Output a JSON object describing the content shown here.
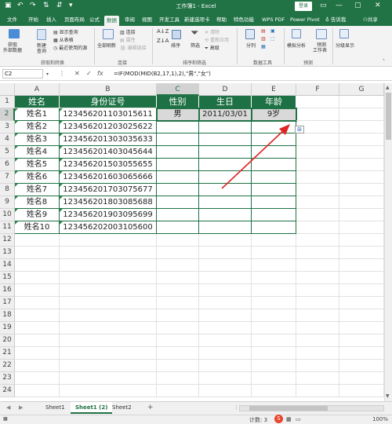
{
  "titlebar": {
    "title": "工作簿1 - Excel",
    "login": "登录",
    "minimize_glyph": "—",
    "restore_glyph": "▢",
    "close_glyph": "✕"
  },
  "tabs": [
    "文件",
    "开始",
    "插入",
    "页面布局",
    "公式",
    "数据",
    "审阅",
    "视图",
    "开发工具",
    "新建选项卡",
    "帮助",
    "特色功能",
    "WPS PDF",
    "Power Pivot"
  ],
  "active_tab": "数据",
  "tell_me": "告诉我",
  "share": "共享",
  "ribbon": {
    "get_data": "获取",
    "get_data2": "外部数据",
    "new_query": "新建",
    "new_query2": "查询",
    "show_query": "显示查询",
    "from_table": "从表格",
    "recent_sources": "最近使用的源",
    "group_get": "获取和转换",
    "refresh_all": "全部刷新",
    "connections": "连接",
    "properties": "属性",
    "edit_links": "编辑链接",
    "group_conn": "连接",
    "sort": "排序",
    "filter": "筛选",
    "clear": "清除",
    "reapply": "重新应用",
    "advanced": "高级",
    "group_sort": "排序和筛选",
    "text_to_cols": "分列",
    "group_tools": "数据工具",
    "what_if": "模拟分析",
    "forecast_sheet": "预测",
    "forecast_sheet2": "工作表",
    "group_forecast": "预测",
    "outline": "分级显示"
  },
  "formula_bar": {
    "name_box": "C2",
    "cancel": "✕",
    "enter": "✓",
    "fx": "fx",
    "formula": "=IF(MOD(MID(B2,17,1),2),\"男\",\"女\")"
  },
  "columns": [
    "A",
    "B",
    "C",
    "D",
    "E",
    "F",
    "G"
  ],
  "rows": [
    "1",
    "2",
    "3",
    "4",
    "5",
    "6",
    "7",
    "8",
    "9",
    "10",
    "11",
    "12",
    "13",
    "14",
    "15",
    "16",
    "17",
    "18",
    "19",
    "20",
    "21",
    "22",
    "23",
    "24"
  ],
  "table": {
    "headers": [
      "姓名",
      "身份证号",
      "性别",
      "生日",
      "年龄"
    ],
    "rows": [
      [
        "姓名1",
        "123456201103015611",
        "男",
        "2011/03/01",
        "9岁"
      ],
      [
        "姓名2",
        "123456201203025622",
        "",
        "",
        ""
      ],
      [
        "姓名3",
        "123456201303035633",
        "",
        "",
        ""
      ],
      [
        "姓名4",
        "123456201403045644",
        "",
        "",
        ""
      ],
      [
        "姓名5",
        "123456201503055655",
        "",
        "",
        ""
      ],
      [
        "姓名6",
        "123456201603065666",
        "",
        "",
        ""
      ],
      [
        "姓名7",
        "123456201703075677",
        "",
        "",
        ""
      ],
      [
        "姓名8",
        "123456201803085688",
        "",
        "",
        ""
      ],
      [
        "姓名9",
        "123456201903095699",
        "",
        "",
        ""
      ],
      [
        "姓名10",
        "123456202003105600",
        "",
        "",
        ""
      ]
    ]
  },
  "sheets": [
    "Sheet1",
    "Sheet1 (2)",
    "Sheet2"
  ],
  "active_sheet": "Sheet1 (2)",
  "add_sheet": "+",
  "status": {
    "count": "计数: 3",
    "zoom": "100%"
  },
  "colors": {
    "excel_green": "#217346",
    "header_fill": "#1e7145",
    "arrow": "#e02424"
  }
}
